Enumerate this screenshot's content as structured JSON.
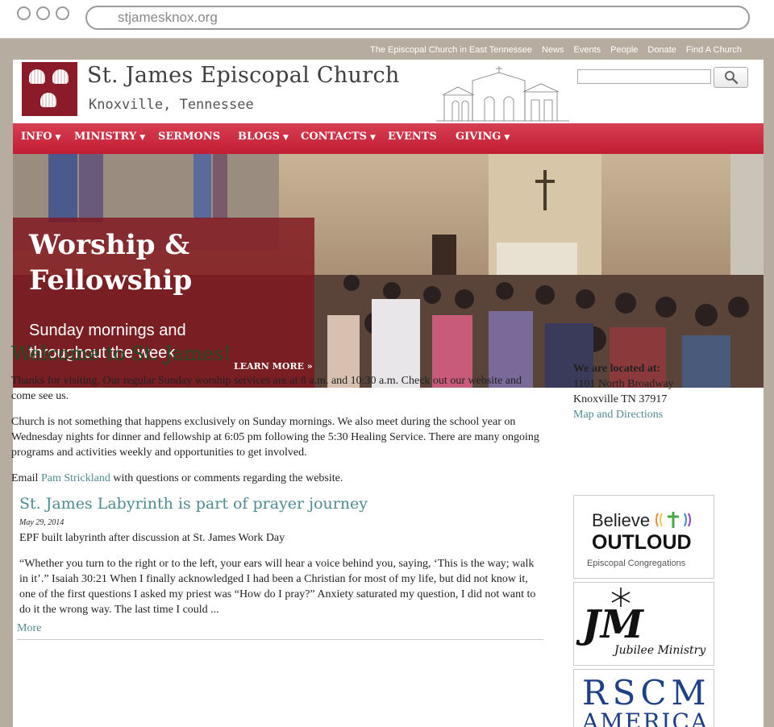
{
  "browser": {
    "url": "stjamesknox.org"
  },
  "toplinks": [
    "The Episcopal Church in East Tennessee",
    "News",
    "Events",
    "People",
    "Donate",
    "Find A Church"
  ],
  "header": {
    "title": "St. James Episcopal Church",
    "subtitle": "Knoxville, Tennessee",
    "search_value": ""
  },
  "nav": [
    {
      "label": "INFO",
      "dropdown": true
    },
    {
      "label": "MINISTRY",
      "dropdown": true
    },
    {
      "label": "SERMONS",
      "dropdown": false
    },
    {
      "label": "BLOGS",
      "dropdown": true
    },
    {
      "label": "CONTACTS",
      "dropdown": true
    },
    {
      "label": "EVENTS",
      "dropdown": false
    },
    {
      "label": "GIVING",
      "dropdown": true
    }
  ],
  "hero": {
    "title_line1": "Worship &",
    "title_line2": "Fellowship",
    "subtitle_line1": "Sunday mornings and",
    "subtitle_line2": "throughout the week",
    "cta": "LEARN MORE »"
  },
  "main": {
    "welcome": "Welcome to St. James!",
    "para1": "Thanks for visiting. Our regular Sunday worship services are at 8 a.m. and 10:30 a.m. Check out our website and come see us.",
    "para2": "Church is not something that happens exclusively on Sunday mornings. We also meet during the school year on Wednesday nights for dinner and fellowship at 6:05 pm following the 5:30 Healing Service. There are many ongoing programs and activities weekly and opportunities to get involved.",
    "email_prefix": "Email",
    "email_link": "Pam Strickland",
    "email_suffix": "with questions or comments regarding the website.",
    "post": {
      "title": "St. James Labyrinth is part of prayer journey",
      "date": "May 29, 2014",
      "subtitle": "EPF built labyrinth after discussion at St. James Work Day",
      "body": "“Whether you turn to the right or to the left, your ears will hear a voice behind you, saying, ‘This is the way; walk in it’.” Isaiah 30:21 When I finally acknowledged I had been a Christian for most of my life, but did not know it, one of the first questions I asked my priest was “How do I pray?” Anxiety saturated my question, I did not want to do it the wrong way. The last time I could ...",
      "more": "More"
    }
  },
  "sidebar": {
    "located_label": "We are located at:",
    "address1": "1101 North Broadway",
    "address2": "Knoxville TN 37917",
    "map_link": "Map and Directions",
    "badges": {
      "believe": {
        "word1": "Believe",
        "word2": "OUTLOUD",
        "caption": "Episcopal Congregations"
      },
      "jubilee": {
        "mark": "JM",
        "caption": "Jubilee Ministry"
      },
      "rscm": {
        "line1": "RSCM",
        "line2": "AMERICA"
      }
    }
  },
  "colors": {
    "nav_red": "#c8283c",
    "hero_box": "#80161e",
    "link_teal": "#4f8b92",
    "heading_green": "#1d4d24"
  }
}
